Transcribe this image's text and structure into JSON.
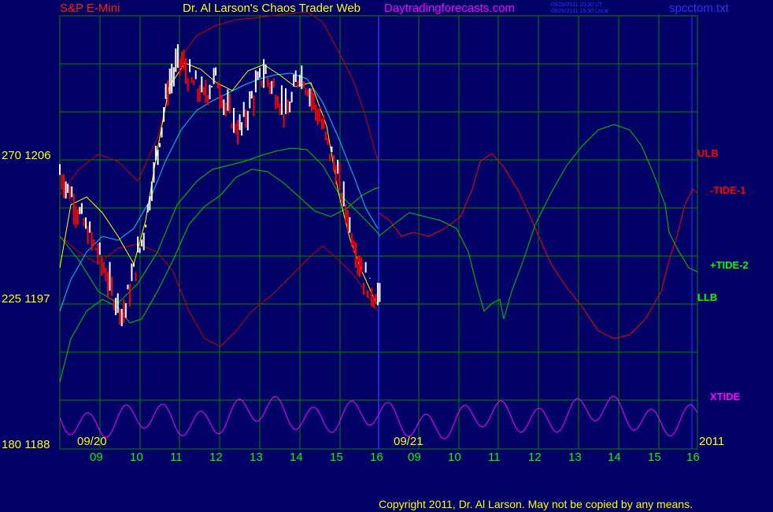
{
  "header": {
    "symbol": "S&P E-Mini",
    "title": "Dr. Al Larson's Chaos Trader Web",
    "site": "Daytradingforecasts.com",
    "time_ut": "09/20/2011 20:30 UT",
    "time_local": "09/20/2011 15:30 Local",
    "file": "spcctom.txt"
  },
  "footer": {
    "copyright": "Copyright 2011, Dr. Al Larson. May not be copied by any means."
  },
  "colors": {
    "background": "#000066",
    "grid": "#008800",
    "divider": "#3333ff",
    "price_up": "#ffffff",
    "price_down": "#ff0000",
    "band": "#cc0000",
    "tide1": "#ff0000",
    "tide2": "#00cc00",
    "llb": "#00cc00",
    "xtide": "#ff00ff",
    "ma_fast": "#ffff00",
    "ma_slow": "#00ccff"
  },
  "chart_data": {
    "type": "line",
    "y_labels": [
      {
        "index": "270",
        "price": "1206"
      },
      {
        "index": "225",
        "price": "1197"
      },
      {
        "index": "180",
        "price": "1188"
      }
    ],
    "ylim": [
      1188,
      1215
    ],
    "date_labels": [
      "09/20",
      "09/21",
      "2011"
    ],
    "hour_ticks": [
      "09",
      "10",
      "11",
      "12",
      "13",
      "14",
      "15",
      "16",
      "09",
      "10",
      "11",
      "12",
      "13",
      "14",
      "15",
      "16"
    ],
    "series_labels": {
      "ulb": "ULB",
      "tide1": "-TIDE-1",
      "tide2": "+TIDE-2",
      "llb": "LLB",
      "xtide": "XTIDE"
    },
    "price_path": [
      [
        0,
        1205.2
      ],
      [
        0.3,
        1203.8
      ],
      [
        0.6,
        1202.0
      ],
      [
        1.0,
        1200.0
      ],
      [
        1.3,
        1197.8
      ],
      [
        1.6,
        1196.5
      ],
      [
        1.8,
        1198.5
      ],
      [
        2.1,
        1201.5
      ],
      [
        2.4,
        1206.0
      ],
      [
        2.7,
        1210.5
      ],
      [
        3.0,
        1212.3
      ],
      [
        3.3,
        1210.8
      ],
      [
        3.6,
        1210.0
      ],
      [
        3.9,
        1211.2
      ],
      [
        4.2,
        1209.0
      ],
      [
        4.5,
        1207.8
      ],
      [
        4.8,
        1209.8
      ],
      [
        5.1,
        1211.5
      ],
      [
        5.4,
        1210.2
      ],
      [
        5.7,
        1208.8
      ],
      [
        6.0,
        1211.6
      ],
      [
        6.3,
        1210.0
      ],
      [
        6.6,
        1207.8
      ],
      [
        6.9,
        1205.5
      ],
      [
        7.2,
        1202.5
      ],
      [
        7.4,
        1200.5
      ],
      [
        7.6,
        1198.8
      ],
      [
        7.8,
        1197.8
      ],
      [
        8.0,
        1197.5
      ]
    ]
  }
}
